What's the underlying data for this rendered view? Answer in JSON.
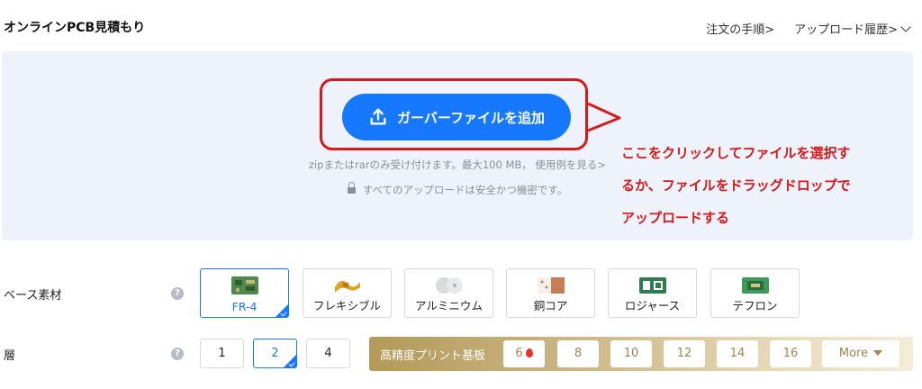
{
  "header": {
    "title": "オンラインPCB見積もり",
    "order_steps": "注文の手順>",
    "upload_history": "アップロード履歴>"
  },
  "upload": {
    "button_label": "ガーバーファイルを追加",
    "hint": "zipまたはrarのみ受け付けます。最大100 MB， 使用例を見る>",
    "secure": "すべてのアップロードは安全かつ機密です。",
    "upload_icon": "upload-icon",
    "lock_icon": "lock-icon"
  },
  "annotation": {
    "line1": "ここをクリックしてファイルを選択す",
    "line2": "るか、ファイルをドラッグドロップで",
    "line3": "アップロードする",
    "color": "#d7191a"
  },
  "base_material": {
    "label": "ベース素材",
    "options": [
      {
        "label": "FR-4",
        "selected": true
      },
      {
        "label": "フレキシブル",
        "selected": false
      },
      {
        "label": "アルミニウム",
        "selected": false
      },
      {
        "label": "銅コア",
        "selected": false
      },
      {
        "label": "ロジャース",
        "selected": false
      },
      {
        "label": "テフロン",
        "selected": false
      }
    ]
  },
  "layers": {
    "label": "層",
    "options": [
      {
        "label": "1",
        "selected": false
      },
      {
        "label": "2",
        "selected": true
      },
      {
        "label": "4",
        "selected": false
      }
    ],
    "high_precision": {
      "label": "高精度プリント基板",
      "options": [
        "6",
        "8",
        "10",
        "12",
        "14",
        "16"
      ],
      "more": "More"
    }
  },
  "colors": {
    "accent": "#1677ff",
    "upload_bg": "#eef3fb",
    "annotation_red": "#d7191a"
  }
}
